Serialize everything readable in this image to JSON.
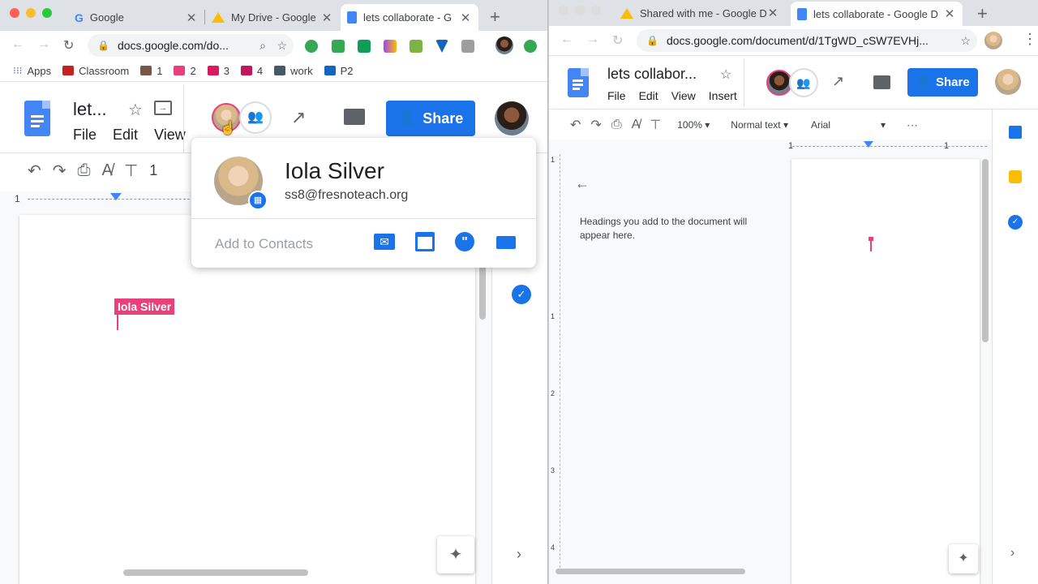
{
  "left_window": {
    "tabs": [
      {
        "title": "Google",
        "icon": "google-icon"
      },
      {
        "title": "My Drive - Google",
        "icon": "drive-icon"
      },
      {
        "title": "lets collaborate - G",
        "icon": "docs-icon"
      }
    ],
    "url": "docs.google.com/do...",
    "bookmarks": [
      {
        "label": "Apps"
      },
      {
        "label": "Classroom"
      },
      {
        "label": "1"
      },
      {
        "label": "2"
      },
      {
        "label": "3"
      },
      {
        "label": "4"
      },
      {
        "label": "work"
      },
      {
        "label": "P2"
      }
    ],
    "doc_title": "let...",
    "menus": [
      "File",
      "Edit",
      "View"
    ],
    "share_label": "Share",
    "ruler_number": "1",
    "font_size_partial": "1",
    "collaborator_cursor_label": "Iola Silver"
  },
  "popup": {
    "name": "Iola Silver",
    "email": "ss8@fresnoteach.org",
    "add_contacts": "Add to Contacts"
  },
  "right_window": {
    "tabs": [
      {
        "title": "Shared with me - Google D",
        "icon": "drive-icon"
      },
      {
        "title": "lets collaborate - Google D",
        "icon": "docs-icon"
      }
    ],
    "url": "docs.google.com/document/d/1TgWD_cSW7EVHj...",
    "doc_title": "lets collabor...",
    "menus": [
      "File",
      "Edit",
      "View",
      "Insert"
    ],
    "share_label": "Share",
    "zoom": "100%",
    "style": "Normal text",
    "font": "Arial",
    "outline_text": "Headings you add to the document will appear here.",
    "ruler_top": [
      "1",
      "1"
    ],
    "ruler_left": [
      "1",
      "1",
      "2",
      "3",
      "4"
    ]
  },
  "colors": {
    "accent": "#1a73e8",
    "cursor_pink": "#e8417a",
    "docs_blue": "#4285f4"
  }
}
